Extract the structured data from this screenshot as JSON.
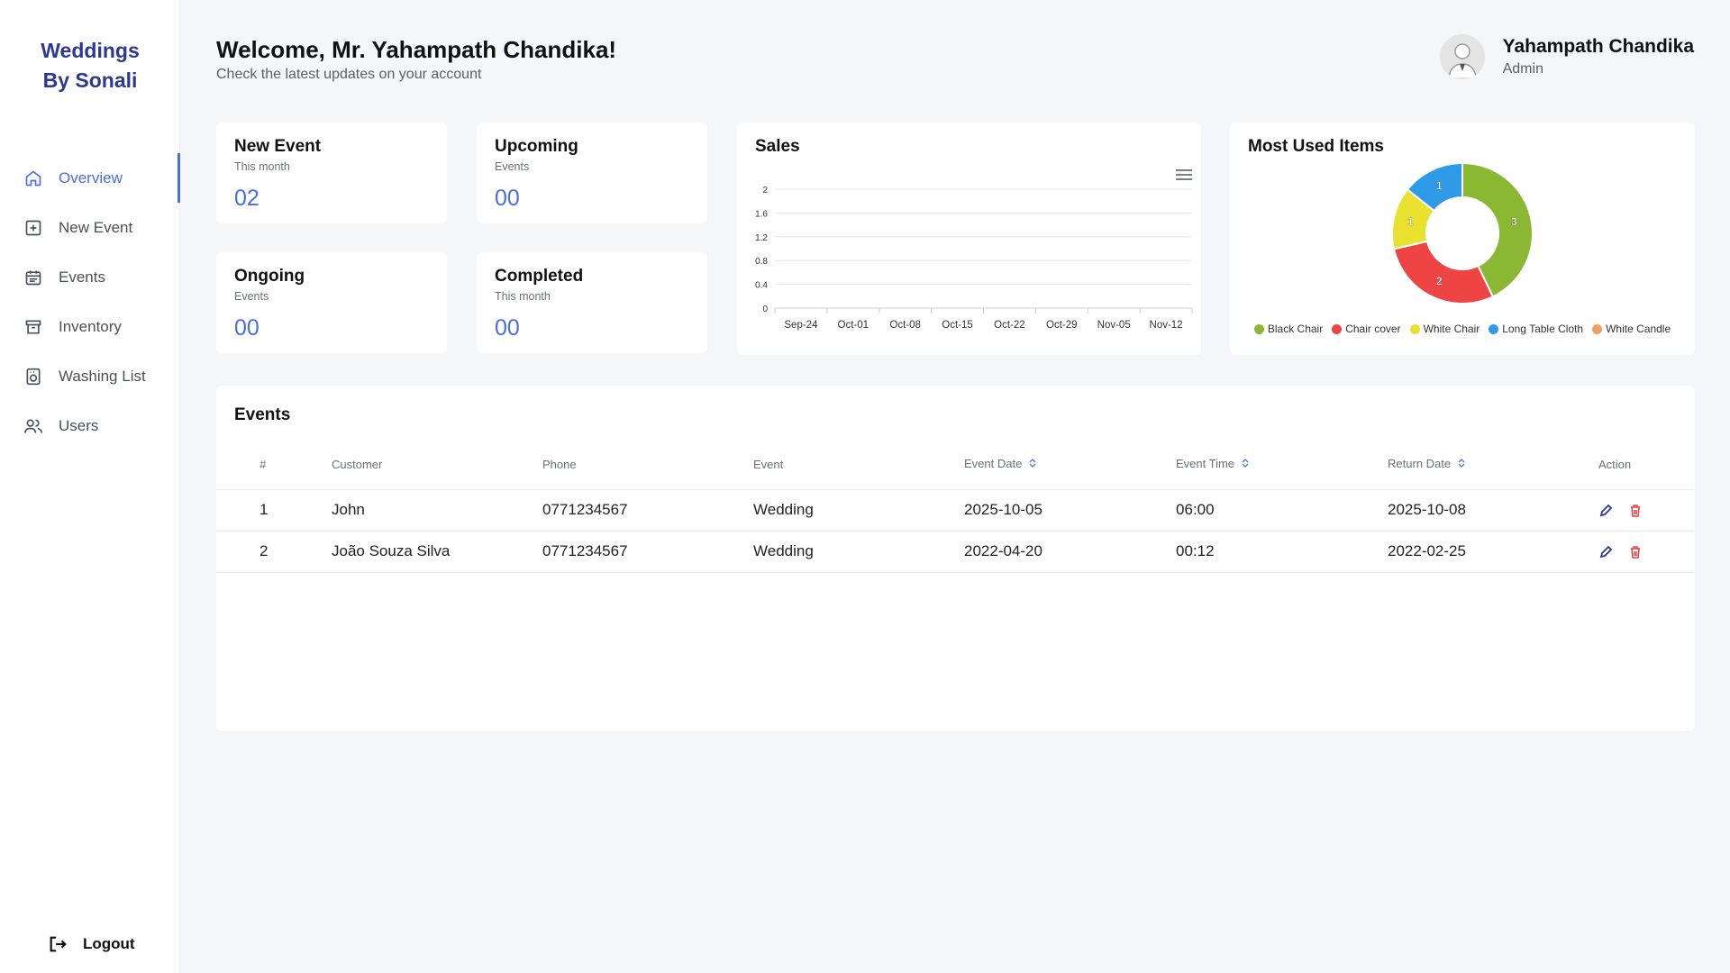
{
  "brand": {
    "line1": "Weddings",
    "line2": "By Sonali"
  },
  "sidebar": {
    "items": [
      {
        "label": "Overview",
        "icon": "home-icon"
      },
      {
        "label": "New Event",
        "icon": "plus-square-icon"
      },
      {
        "label": "Events",
        "icon": "calendar-icon"
      },
      {
        "label": "Inventory",
        "icon": "archive-box-icon"
      },
      {
        "label": "Washing List",
        "icon": "washing-machine-icon"
      },
      {
        "label": "Users",
        "icon": "users-icon"
      }
    ],
    "logout": "Logout"
  },
  "header": {
    "welcome": "Welcome, Mr. Yahampath Chandika!",
    "subtitle": "Check the latest updates on your account"
  },
  "profile": {
    "name": "Yahampath Chandika",
    "role": "Admin"
  },
  "stats": [
    {
      "title": "New Event",
      "subtitle": "This month",
      "value": "02"
    },
    {
      "title": "Upcoming",
      "subtitle": "Events",
      "value": "00"
    },
    {
      "title": "Ongoing",
      "subtitle": "Events",
      "value": "00"
    },
    {
      "title": "Completed",
      "subtitle": "This month",
      "value": "00"
    }
  ],
  "sales": {
    "title": "Sales"
  },
  "most_used": {
    "title": "Most Used Items"
  },
  "chart_data": [
    {
      "type": "line",
      "title": "Sales",
      "categories": [
        "Sep-24",
        "Oct-01",
        "Oct-08",
        "Oct-15",
        "Oct-22",
        "Oct-29",
        "Nov-05",
        "Nov-12"
      ],
      "series": [],
      "y_ticks": [
        "0",
        "0.4",
        "0.8",
        "1.2",
        "1.6",
        "2"
      ],
      "ylim": [
        0,
        2
      ],
      "grid": true
    },
    {
      "type": "pie",
      "title": "Most Used Items",
      "donut": true,
      "slices": [
        {
          "name": "Black Chair",
          "value": 3,
          "color": "#8ab833"
        },
        {
          "name": "Chair cover",
          "value": 2,
          "color": "#ef4444"
        },
        {
          "name": "White Chair",
          "value": 1,
          "color": "#e8e22f"
        },
        {
          "name": "Long Table Cloth",
          "value": 1,
          "color": "#2f9be8"
        },
        {
          "name": "White Candle",
          "value": 0,
          "color": "#f0a060"
        }
      ],
      "legend": "bottom"
    }
  ],
  "events": {
    "title": "Events",
    "columns": [
      "#",
      "Customer",
      "Phone",
      "Event",
      "Event Date",
      "Event Time",
      "Return Date",
      "Action"
    ],
    "rows": [
      {
        "num": "1",
        "customer": "John",
        "phone": "0771234567",
        "event": "Wedding",
        "event_date": "2025-10-05",
        "event_time": "06:00",
        "return_date": "2025-10-08"
      },
      {
        "num": "2",
        "customer": "João Souza Silva",
        "phone": "0771234567",
        "event": "Wedding",
        "event_date": "2022-04-20",
        "event_time": "00:12",
        "return_date": "2022-02-25"
      }
    ]
  },
  "colors": {
    "accent": "#4a6fdc",
    "brand": "#2b3990",
    "edit": "#2b3990",
    "delete": "#e53e3e"
  }
}
